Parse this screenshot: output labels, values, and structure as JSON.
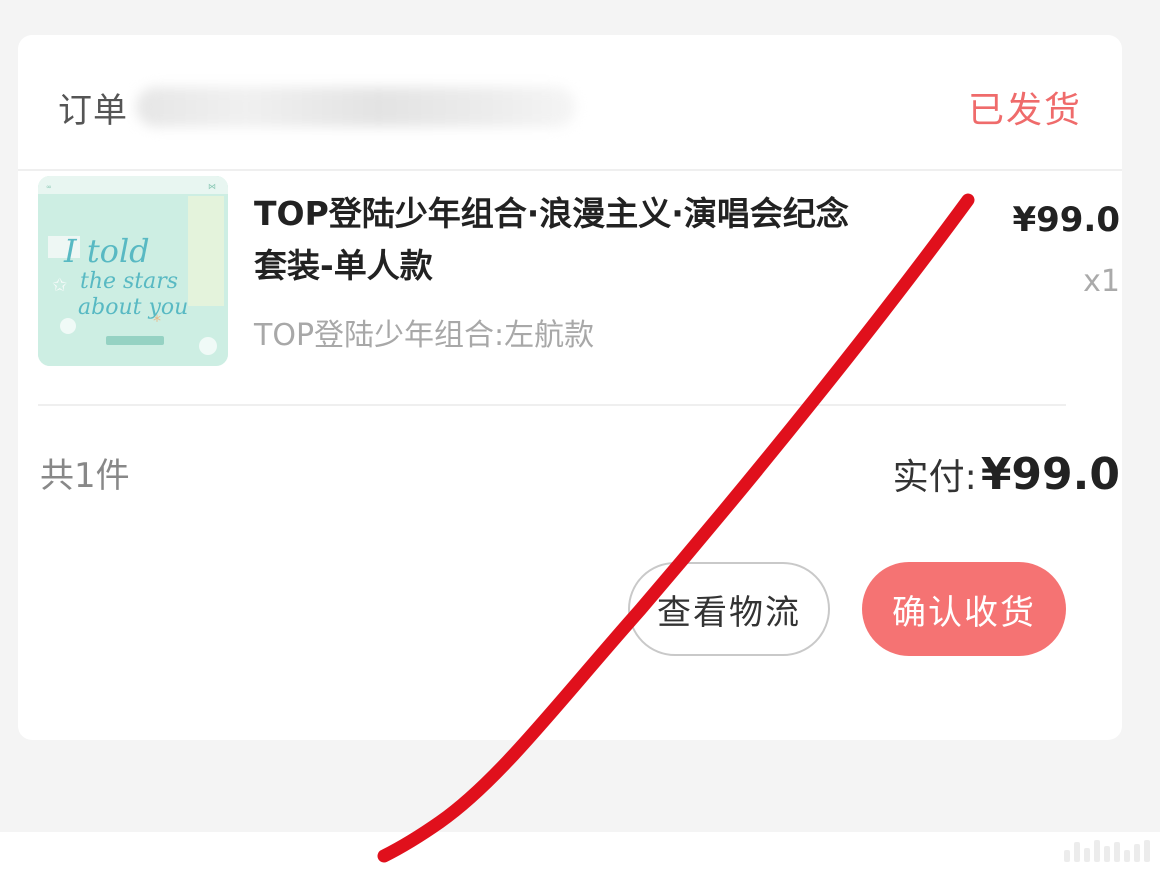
{
  "order": {
    "label": "订单",
    "status": "已发货"
  },
  "product": {
    "title": "TOP登陆少年组合·浪漫主义·演唱会纪念套装-单人款",
    "variant": "TOP登陆少年组合:左航款",
    "price": "¥99.0",
    "quantity": "x1",
    "thumbnail_text": [
      "I told",
      "the stars",
      "about you"
    ]
  },
  "summary": {
    "count_text": "共1件",
    "paid_label": "实付:",
    "paid_amount": "¥99.0"
  },
  "actions": {
    "logistics_label": "查看物流",
    "confirm_label": "确认收货"
  },
  "colors": {
    "status": "#ef6b6b",
    "confirm_button": "#f57373",
    "annotation_stroke": "#e0101c"
  }
}
